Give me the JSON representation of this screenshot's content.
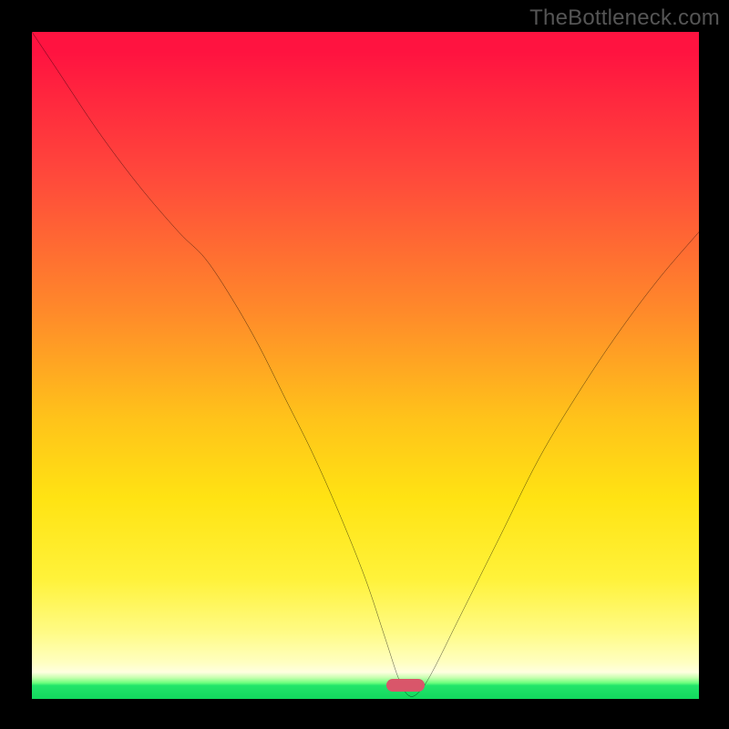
{
  "watermark": "TheBottleneck.com",
  "colors": {
    "frame_bg": "#000000",
    "curve": "#000000",
    "marker": "#d9566a"
  },
  "chart_data": {
    "type": "line",
    "title": "",
    "xlabel": "",
    "ylabel": "",
    "xlim": [
      0,
      100
    ],
    "ylim": [
      0,
      100
    ],
    "grid": false,
    "legend": false,
    "series": [
      {
        "name": "bottleneck-curve",
        "x": [
          0,
          4,
          10,
          16,
          22,
          26,
          30,
          34,
          38,
          42,
          46,
          50,
          53,
          55,
          56.5,
          58,
          60,
          64,
          70,
          76,
          82,
          88,
          94,
          100
        ],
        "values": [
          100,
          94,
          85,
          77,
          70,
          66,
          60,
          53,
          45,
          37,
          28,
          18,
          9,
          3,
          0.5,
          1,
          4,
          12,
          24,
          36,
          46,
          55,
          63,
          70
        ]
      }
    ],
    "marker": {
      "x": 56,
      "y": 2,
      "label": ""
    },
    "notes": "Axes are unlabeled; values are read as percentage of chart width/height. Curve descends steeply from top-left, bottoms out near x≈56, then rises to the right. Background is a vertical red→orange→yellow gradient with a thin green band at the bottom."
  }
}
